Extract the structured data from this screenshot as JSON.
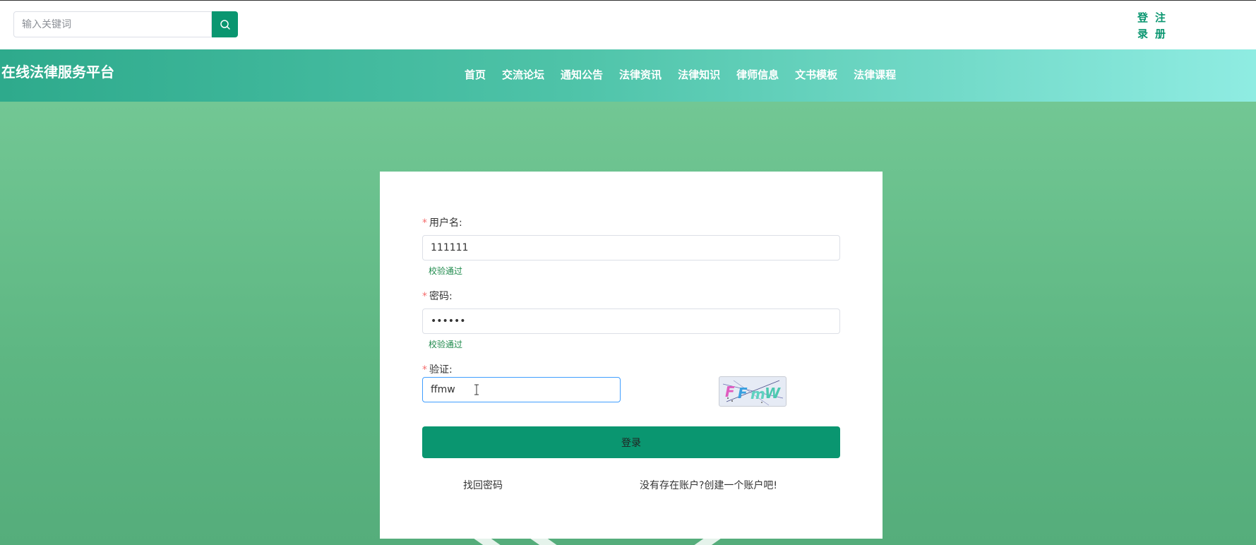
{
  "header": {
    "search": {
      "placeholder": "输入关键词",
      "value": ""
    },
    "auth": {
      "login": [
        "登",
        "录"
      ],
      "register": [
        "注",
        "册"
      ]
    }
  },
  "nav": {
    "site_title": "在线法律服务平台",
    "items": [
      {
        "label": "首页"
      },
      {
        "label": "交流论坛"
      },
      {
        "label": "通知公告"
      },
      {
        "label": "法律资讯"
      },
      {
        "label": "法律知识"
      },
      {
        "label": "律师信息"
      },
      {
        "label": "文书模板"
      },
      {
        "label": "法律课程"
      }
    ]
  },
  "login_form": {
    "required_mark": "*",
    "username": {
      "label": "用户名:",
      "value": "111111",
      "hint": "校验通过"
    },
    "password": {
      "label": "密码:",
      "value": "111111",
      "hint": "校验通过"
    },
    "captcha": {
      "label": "验证:",
      "value": "ffmw",
      "image_text": "FFmW"
    },
    "submit_label": "登录",
    "forgot_link": "找回密码",
    "register_link": "没有存在账户?创建一个账户吧!"
  },
  "colors": {
    "brand": "#0a9670",
    "hint_ok": "#1f8a4c",
    "required": "#f56c6c"
  }
}
